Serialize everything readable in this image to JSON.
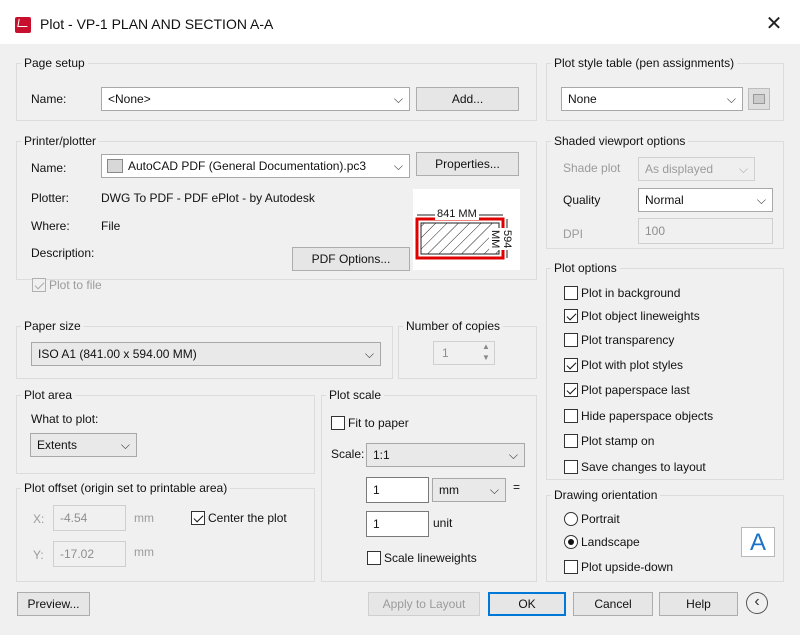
{
  "window": {
    "title": "Plot - VP-1 PLAN AND SECTION A-A",
    "close": "✕"
  },
  "page_setup": {
    "title": "Page setup",
    "name_label": "Name:",
    "name_value": "<None>",
    "add_button": "Add..."
  },
  "printer": {
    "title": "Printer/plotter",
    "name_label": "Name:",
    "name_value": "AutoCAD PDF (General Documentation).pc3",
    "properties_button": "Properties...",
    "plotter_label": "Plotter:",
    "plotter_value": "DWG To PDF - PDF ePlot - by Autodesk",
    "where_label": "Where:",
    "where_value": "File",
    "description_label": "Description:",
    "plot_to_file_label": "Plot to file",
    "plot_to_file_checked": true,
    "pdf_options_button": "PDF Options...",
    "preview": {
      "width_text": "841 MM",
      "height_text": "594 MM"
    }
  },
  "paper_size": {
    "title": "Paper size",
    "value": "ISO A1 (841.00 x 594.00 MM)"
  },
  "copies": {
    "title": "Number of copies",
    "value": "1"
  },
  "plot_area": {
    "title": "Plot area",
    "what_label": "What to plot:",
    "what_value": "Extents"
  },
  "plot_scale": {
    "title": "Plot scale",
    "fit_label": "Fit to paper",
    "fit_checked": false,
    "scale_label": "Scale:",
    "scale_value": "1:1",
    "value1": "1",
    "unit1": "mm",
    "equals": "=",
    "value2": "1",
    "unit2": "unit",
    "lineweights_label": "Scale lineweights",
    "lineweights_checked": false
  },
  "plot_offset": {
    "title": "Plot offset (origin set to printable area)",
    "x_label": "X:",
    "x_value": "-4.54",
    "x_unit": "mm",
    "y_label": "Y:",
    "y_value": "-17.02",
    "y_unit": "mm",
    "center_label": "Center the plot",
    "center_checked": true
  },
  "plot_style": {
    "title": "Plot style table (pen assignments)",
    "value": "None"
  },
  "shaded": {
    "title": "Shaded viewport options",
    "shade_label": "Shade plot",
    "shade_value": "As displayed",
    "quality_label": "Quality",
    "quality_value": "Normal",
    "dpi_label": "DPI",
    "dpi_value": "100"
  },
  "plot_options": {
    "title": "Plot options",
    "items": [
      {
        "label": "Plot in background",
        "checked": false
      },
      {
        "label": "Plot object lineweights",
        "checked": true
      },
      {
        "label": "Plot transparency",
        "checked": false
      },
      {
        "label": "Plot with plot styles",
        "checked": true
      },
      {
        "label": "Plot paperspace last",
        "checked": true
      },
      {
        "label": "Hide paperspace objects",
        "checked": false
      },
      {
        "label": "Plot stamp on",
        "checked": false
      },
      {
        "label": "Save changes to layout",
        "checked": false
      }
    ]
  },
  "orientation": {
    "title": "Drawing orientation",
    "portrait": "Portrait",
    "landscape": "Landscape",
    "selected": "Landscape",
    "upside_down": "Plot upside-down",
    "upside_down_checked": false,
    "icon_letter": "A"
  },
  "footer": {
    "preview": "Preview...",
    "apply": "Apply to Layout",
    "ok": "OK",
    "cancel": "Cancel",
    "help": "Help",
    "more": "‹"
  },
  "colors": {
    "accent": "#0078d7",
    "preview_border": "#e00000"
  }
}
